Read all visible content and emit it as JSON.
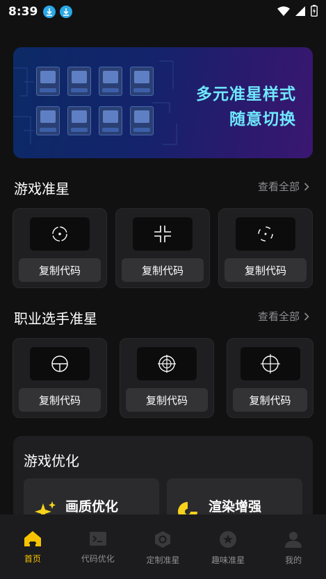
{
  "status_bar": {
    "time": "8:39"
  },
  "banner": {
    "line1": "多元准星样式",
    "line2": "随意切换"
  },
  "game_crosshairs": {
    "title": "游戏准星",
    "see_all": "查看全部",
    "cards": [
      {
        "icon": "dot-ring-crosshair-icon",
        "button": "复制代码"
      },
      {
        "icon": "corner-crosshair-icon",
        "button": "复制代码"
      },
      {
        "icon": "dashed-circle-crosshair-icon",
        "button": "复制代码"
      }
    ]
  },
  "pro_crosshairs": {
    "title": "职业选手准星",
    "see_all": "查看全部",
    "cards": [
      {
        "icon": "scope-crosshair-icon",
        "button": "复制代码"
      },
      {
        "icon": "target-crosshair-icon",
        "button": "复制代码"
      },
      {
        "icon": "circle-cross-crosshair-icon",
        "button": "复制代码"
      }
    ]
  },
  "game_optimization": {
    "title": "游戏优化",
    "items": [
      {
        "label": "画质优化",
        "icon": "sparkle-icon"
      },
      {
        "label": "渲染增强",
        "icon": "render-icon"
      }
    ]
  },
  "tabbar": {
    "active_color": "#f7c300",
    "tabs": [
      {
        "label": "首页",
        "icon": "home-icon",
        "active": true
      },
      {
        "label": "代码优化",
        "icon": "terminal-icon",
        "active": false
      },
      {
        "label": "定制准星",
        "icon": "hexagon-icon",
        "active": false
      },
      {
        "label": "趣味准星",
        "icon": "star-icon",
        "active": false
      },
      {
        "label": "我的",
        "icon": "user-icon",
        "active": false
      }
    ]
  }
}
